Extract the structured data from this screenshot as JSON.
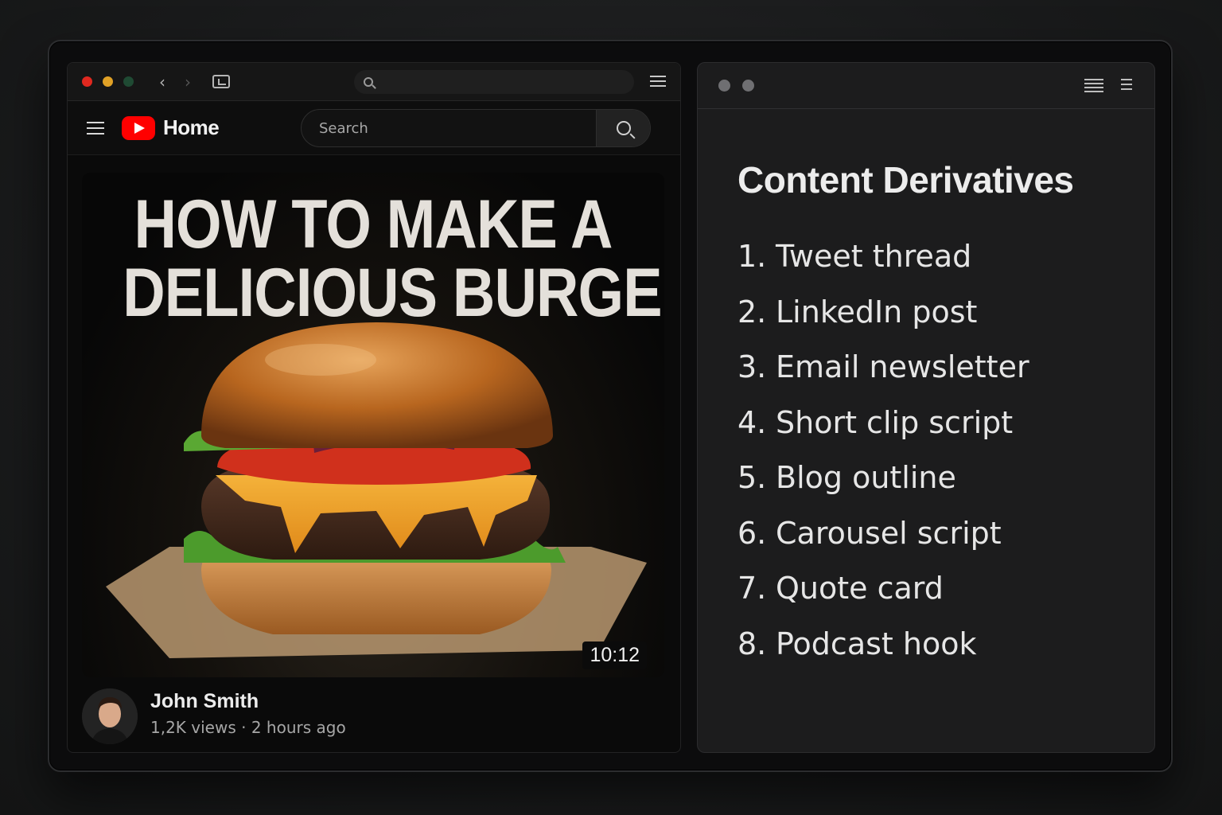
{
  "left_window": {
    "address_bar": {
      "value": ""
    },
    "youtube": {
      "page_label": "Home",
      "search": {
        "placeholder": "Search"
      }
    },
    "video": {
      "thumbnail_title_lines": [
        "HOW TO MAKE A",
        "DELICIOUS BURGER"
      ],
      "duration": "10:12",
      "channel": "John Smith",
      "stats": "1,2K views · 2 hours ago"
    }
  },
  "right_window": {
    "heading": "Content Derivatives",
    "items": [
      {
        "num": "1.",
        "label": "Tweet thread"
      },
      {
        "num": "2.",
        "label": "LinkedIn post"
      },
      {
        "num": "3.",
        "label": "Email newsletter"
      },
      {
        "num": "4.",
        "label": "Short clip script"
      },
      {
        "num": "5.",
        "label": "Blog outline"
      },
      {
        "num": "6.",
        "label": "Carousel script"
      },
      {
        "num": "7.",
        "label": "Quote card"
      },
      {
        "num": "8.",
        "label": "Podcast hook"
      }
    ]
  },
  "colors": {
    "youtube_red": "#ff0000",
    "traffic_red": "#e0281f",
    "traffic_yellow": "#e0a126",
    "traffic_green": "#1f4a33"
  },
  "icons": [
    "hamburger-menu-icon",
    "youtube-logo-icon",
    "search-icon",
    "back-chevron-icon",
    "forward-chevron-icon",
    "tab-overview-icon",
    "menu-lines-icon",
    "list-icon"
  ]
}
